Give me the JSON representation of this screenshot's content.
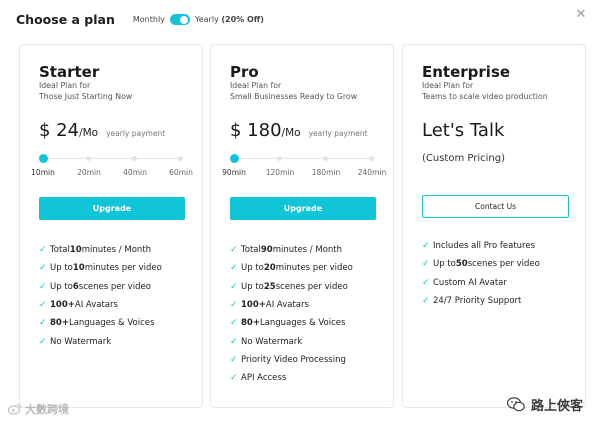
{
  "header": {
    "title": "Choose a plan",
    "monthly_label": "Monthly",
    "yearly_label": "Yearly",
    "yearly_discount": "(20% Off)",
    "toggle_state": "yearly"
  },
  "close_label": "✕",
  "plans": [
    {
      "name": "Starter",
      "desc1": "Ideal Plan for",
      "desc2": "Those Just Starting Now",
      "price": "$ 24",
      "per": "/Mo",
      "payment": "yearly payment",
      "slider": {
        "selected": "10min",
        "ticks": [
          "10min",
          "20min",
          "40min",
          "60min"
        ]
      },
      "button": "Upgrade",
      "features": [
        {
          "pre": "Total ",
          "bold": "10",
          "post": " minutes / Month"
        },
        {
          "pre": "Up to ",
          "bold": "10",
          "post": " minutes per video"
        },
        {
          "pre": "Up to ",
          "bold": "6",
          "post": " scenes per video"
        },
        {
          "pre": "",
          "bold": "100+",
          "post": " AI Avatars"
        },
        {
          "pre": "",
          "bold": "80+",
          "post": " Languages & Voices"
        },
        {
          "pre": "No Watermark",
          "bold": "",
          "post": ""
        }
      ]
    },
    {
      "name": "Pro",
      "desc1": "Ideal Plan for",
      "desc2": "Small Businesses Ready to Grow",
      "price": "$ 180",
      "per": "/Mo",
      "payment": "yearly payment",
      "slider": {
        "selected": "90min",
        "ticks": [
          "90min",
          "120min",
          "180min",
          "240min"
        ]
      },
      "button": "Upgrade",
      "features": [
        {
          "pre": "Total ",
          "bold": "90",
          "post": " minutes / Month"
        },
        {
          "pre": "Up to ",
          "bold": "20",
          "post": " minutes per video"
        },
        {
          "pre": "Up to ",
          "bold": "25",
          "post": " scenes per video"
        },
        {
          "pre": "",
          "bold": "100+",
          "post": " AI Avatars"
        },
        {
          "pre": "",
          "bold": "80+",
          "post": " Languages & Voices"
        },
        {
          "pre": "No Watermark",
          "bold": "",
          "post": ""
        },
        {
          "pre": "Priority Video Processing",
          "bold": "",
          "post": ""
        },
        {
          "pre": "API Access",
          "bold": "",
          "post": ""
        }
      ]
    },
    {
      "name": "Enterprise",
      "desc1": "Ideal Plan for",
      "desc2": "Teams to scale video production",
      "headline": "Let's Talk",
      "sub": "(Custom Pricing)",
      "button": "Contact Us",
      "features": [
        {
          "pre": "Includes all Pro features",
          "bold": "",
          "post": ""
        },
        {
          "pre": "Up to ",
          "bold": "50",
          "post": " scenes per video"
        },
        {
          "pre": "Custom AI Avatar",
          "bold": "",
          "post": ""
        },
        {
          "pre": "24/7 Priority Support",
          "bold": "",
          "post": ""
        }
      ]
    }
  ],
  "check_glyph": "✓",
  "colors": {
    "accent": "#11c4d8",
    "text": "#1e1e1e",
    "muted": "#777777",
    "border": "#e8e8e8"
  },
  "watermarks": {
    "left": "大數跨境",
    "right": "路上俠客"
  }
}
